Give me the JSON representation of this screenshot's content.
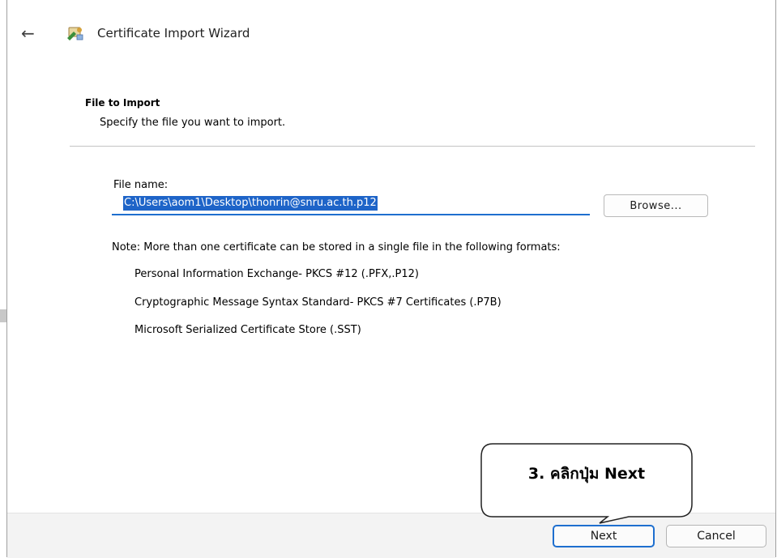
{
  "window": {
    "title": "Certificate Import Wizard",
    "back_icon": "back-arrow-icon",
    "app_icon": "certificate-wizard-icon"
  },
  "section": {
    "title": "File to Import",
    "subtitle": "Specify the file you want to import."
  },
  "file_field": {
    "label": "File name:",
    "value": "C:\\Users\\aom1\\Desktop\\thonrin@snru.ac.th.p12"
  },
  "browse_button": "Browse...",
  "note": "Note:  More than one certificate can be stored in a single file in the following formats:",
  "formats": [
    "Personal Information Exchange- PKCS #12 (.PFX,.P12)",
    "Cryptographic Message Syntax Standard- PKCS #7 Certificates (.P7B)",
    "Microsoft Serialized Certificate Store (.SST)"
  ],
  "footer": {
    "next_label": "Next",
    "cancel_label": "Cancel"
  },
  "annotation": {
    "callout_text": "3. คลิกปุ่ม Next"
  },
  "colors": {
    "accent": "#1e6fcf",
    "selection": "#1e64c8",
    "footer_bg": "#f3f3f3"
  }
}
